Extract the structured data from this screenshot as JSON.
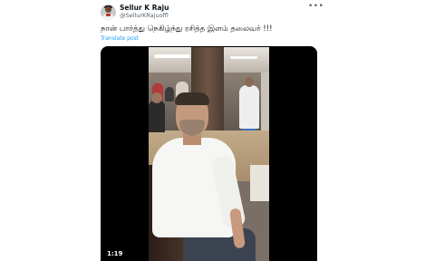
{
  "author": {
    "name": "Sellur K Raju",
    "handle": "@SellurKRajuoffl"
  },
  "tweet": {
    "text": "நான் பார்த்து நெகிழ்ந்து ரசித்த இளம் தலைவர் !!!",
    "translate_label": "Translate post"
  },
  "media": {
    "duration": "1:19"
  },
  "icons": {
    "more": "more-options-icon",
    "avatar": "profile-avatar"
  }
}
